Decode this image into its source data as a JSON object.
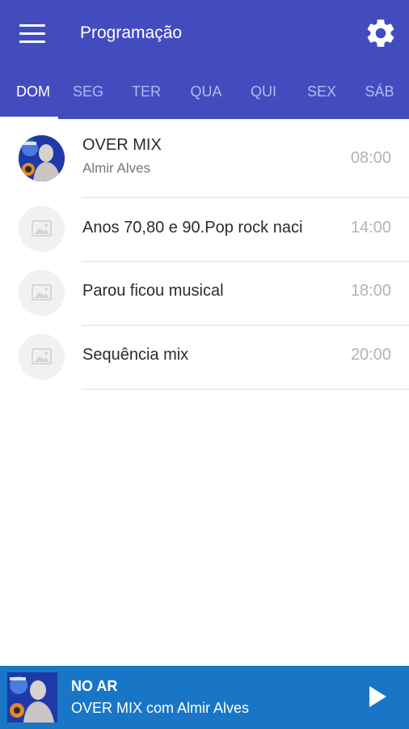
{
  "header": {
    "title": "Programação",
    "menu_icon": "hamburger-menu-icon",
    "settings_icon": "gear-icon",
    "color": "#434cbf"
  },
  "tabs": [
    {
      "label": "DOM",
      "active": true
    },
    {
      "label": "SEG",
      "active": false
    },
    {
      "label": "TER",
      "active": false
    },
    {
      "label": "QUA",
      "active": false
    },
    {
      "label": "QUI",
      "active": false
    },
    {
      "label": "SEX",
      "active": false
    },
    {
      "label": "SÁB",
      "active": false
    }
  ],
  "schedule": [
    {
      "title": "OVER MIX",
      "host": "Almir Alves",
      "time": "08:00",
      "thumb": "host-photo"
    },
    {
      "title": "Anos 70,80 e 90.Pop rock naci",
      "host": "",
      "time": "14:00",
      "thumb": "image-placeholder-icon"
    },
    {
      "title": "Parou ficou musical",
      "host": "",
      "time": "18:00",
      "thumb": "image-placeholder-icon"
    },
    {
      "title": "Sequência mix",
      "host": "",
      "time": "20:00",
      "thumb": "image-placeholder-icon"
    }
  ],
  "player": {
    "status": "NO AR",
    "now_playing": "OVER MIX com Almir Alves",
    "play_icon": "play-icon",
    "color": "#1976c6"
  }
}
